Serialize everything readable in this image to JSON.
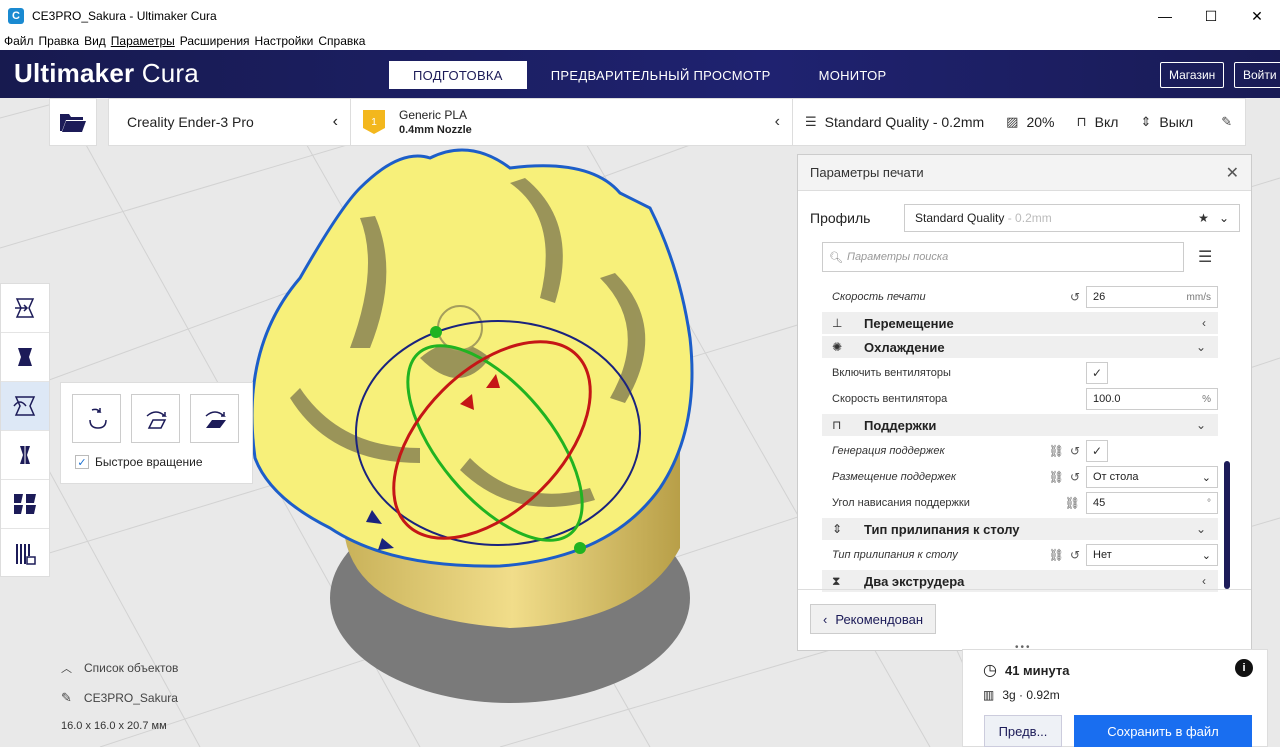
{
  "window": {
    "title": "CE3PRO_Sakura - Ultimaker Cura",
    "controls": [
      "—",
      "☐",
      "✕"
    ]
  },
  "menu": [
    "Файл",
    "Правка",
    "Вид",
    "Параметры",
    "Расширения",
    "Настройки",
    "Справка"
  ],
  "header": {
    "logo_brand": "Ultimaker",
    "logo_product": "Cura",
    "tabs": [
      "ПОДГОТОВКА",
      "ПРЕДВАРИТЕЛЬНЫЙ ПРОСМОТР",
      "МОНИТОР"
    ],
    "active_tab": "ПОДГОТОВКА",
    "marketplace": "Магазин",
    "signin": "Войти"
  },
  "machine_bar": {
    "printer": "Creality Ender-3 Pro",
    "material_badge": "1",
    "material_name": "Generic PLA",
    "nozzle": "0.4mm Nozzle",
    "quality": "Standard Quality - 0.2mm",
    "infill": "20%",
    "support": "Вкл",
    "adhesion": "Выкл"
  },
  "rotate_panel": {
    "quick_rotate_label": "Быстрое вращение",
    "quick_rotate_checked": true
  },
  "objects": {
    "list_label": "Список объектов",
    "name": "CE3PRO_Sakura",
    "dims": "16.0 x 16.0 x 20.7 мм"
  },
  "settings_panel": {
    "title": "Параметры печати",
    "profile_label": "Профиль",
    "profile_value": "Standard Quality",
    "profile_suffix": " - 0.2mm",
    "search_placeholder": "Параметры поиска",
    "rows": {
      "print_speed": {
        "label": "Скорость печати",
        "value": "26",
        "unit": "mm/s"
      },
      "cat_travel": "Перемещение",
      "cat_cooling": "Охлаждение",
      "enable_fans": {
        "label": "Включить вентиляторы",
        "value": "✓"
      },
      "fan_speed": {
        "label": "Скорость вентилятора",
        "value": "100.0",
        "unit": "%"
      },
      "cat_support": "Поддержки",
      "support_gen": {
        "label": "Генерация поддержек",
        "value": "✓"
      },
      "support_place": {
        "label": "Размещение поддержек",
        "value": "От стола"
      },
      "support_angle": {
        "label": "Угол нависания поддержки",
        "value": "45",
        "unit": "°"
      },
      "cat_adhesion": "Тип прилипания к столу",
      "adhesion_type": {
        "label": "Тип прилипания к столу",
        "value": "Нет"
      },
      "cat_dual": "Два экструдера"
    },
    "recommended_button": "Рекомендован"
  },
  "action_panel": {
    "time": "41 минута",
    "material": "3g · 0.92m",
    "preview_button": "Предв...",
    "save_button": "Сохранить в файл"
  },
  "colors": {
    "header_bg": "#1c1b58",
    "model_yellow": "#f7f07a",
    "accent_blue": "#196ef0"
  }
}
